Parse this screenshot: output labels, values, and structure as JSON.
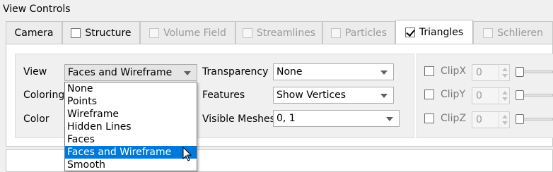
{
  "window": {
    "title": "View Controls"
  },
  "tabs": [
    {
      "label": "Camera",
      "checkbox": false,
      "checked": false,
      "disabled": false,
      "active": false
    },
    {
      "label": "Structure",
      "checkbox": true,
      "checked": false,
      "disabled": false,
      "active": false
    },
    {
      "label": "Volume Field",
      "checkbox": true,
      "checked": false,
      "disabled": true,
      "active": false
    },
    {
      "label": "Streamlines",
      "checkbox": true,
      "checked": false,
      "disabled": true,
      "active": false
    },
    {
      "label": "Particles",
      "checkbox": true,
      "checked": false,
      "disabled": true,
      "active": false
    },
    {
      "label": "Triangles",
      "checkbox": true,
      "checked": true,
      "disabled": false,
      "active": true
    },
    {
      "label": "Schlieren",
      "checkbox": true,
      "checked": false,
      "disabled": true,
      "active": false
    }
  ],
  "form": {
    "view_label": "View",
    "view_value": "Faces and Wireframe",
    "coloring_label": "Coloring",
    "color_label": "Color",
    "transparency_label": "Transparency",
    "transparency_value": "None",
    "features_label": "Features",
    "features_value": "Show Vertices",
    "visible_meshes_label": "Visible Meshes",
    "visible_meshes_value": "0, 1"
  },
  "view_dropdown": {
    "options": [
      "None",
      "Points",
      "Wireframe",
      "Hidden Lines",
      "Faces",
      "Faces and Wireframe",
      "Smooth"
    ],
    "highlighted": "Faces and Wireframe"
  },
  "clip": {
    "items": [
      {
        "label": "ClipX",
        "value": "0"
      },
      {
        "label": "ClipY",
        "value": "0"
      },
      {
        "label": "ClipZ",
        "value": "0"
      }
    ]
  },
  "colors": {
    "selection": "#0078d7",
    "disabled_text": "#9a9a9a"
  }
}
